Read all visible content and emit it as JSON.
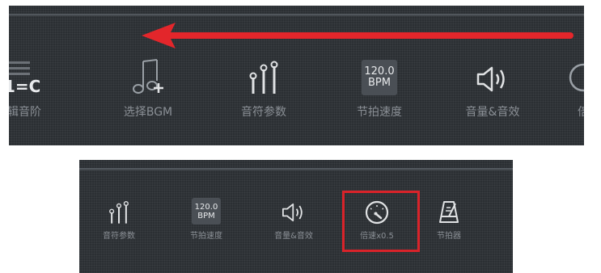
{
  "top_panel": {
    "items": [
      {
        "icon": "key-signature-icon",
        "icon_text": "1=C",
        "label": "编辑音阶"
      },
      {
        "icon": "music-note-add-icon",
        "label": "选择BGM"
      },
      {
        "icon": "sliders-icon",
        "label": "音符参数"
      },
      {
        "icon": "bpm-icon",
        "bpm_value": "120.0",
        "bpm_unit": "BPM",
        "label": "节拍速度"
      },
      {
        "icon": "speaker-icon",
        "label": "音量&音效"
      },
      {
        "icon": "speed-dial-icon",
        "label": "倍"
      }
    ]
  },
  "bottom_panel": {
    "items": [
      {
        "icon": "sliders-icon",
        "label": "音符参数"
      },
      {
        "icon": "bpm-icon",
        "bpm_value": "120.0",
        "bpm_unit": "BPM",
        "label": "节拍速度"
      },
      {
        "icon": "speaker-icon",
        "label": "音量&音效"
      },
      {
        "icon": "speed-dial-icon",
        "label": "倍速x0.5"
      },
      {
        "icon": "metronome-icon",
        "label": "节拍器"
      }
    ]
  },
  "colors": {
    "panel_bg": "#2b2f33",
    "arrow": "#e3262b",
    "highlight": "#d9232a"
  }
}
